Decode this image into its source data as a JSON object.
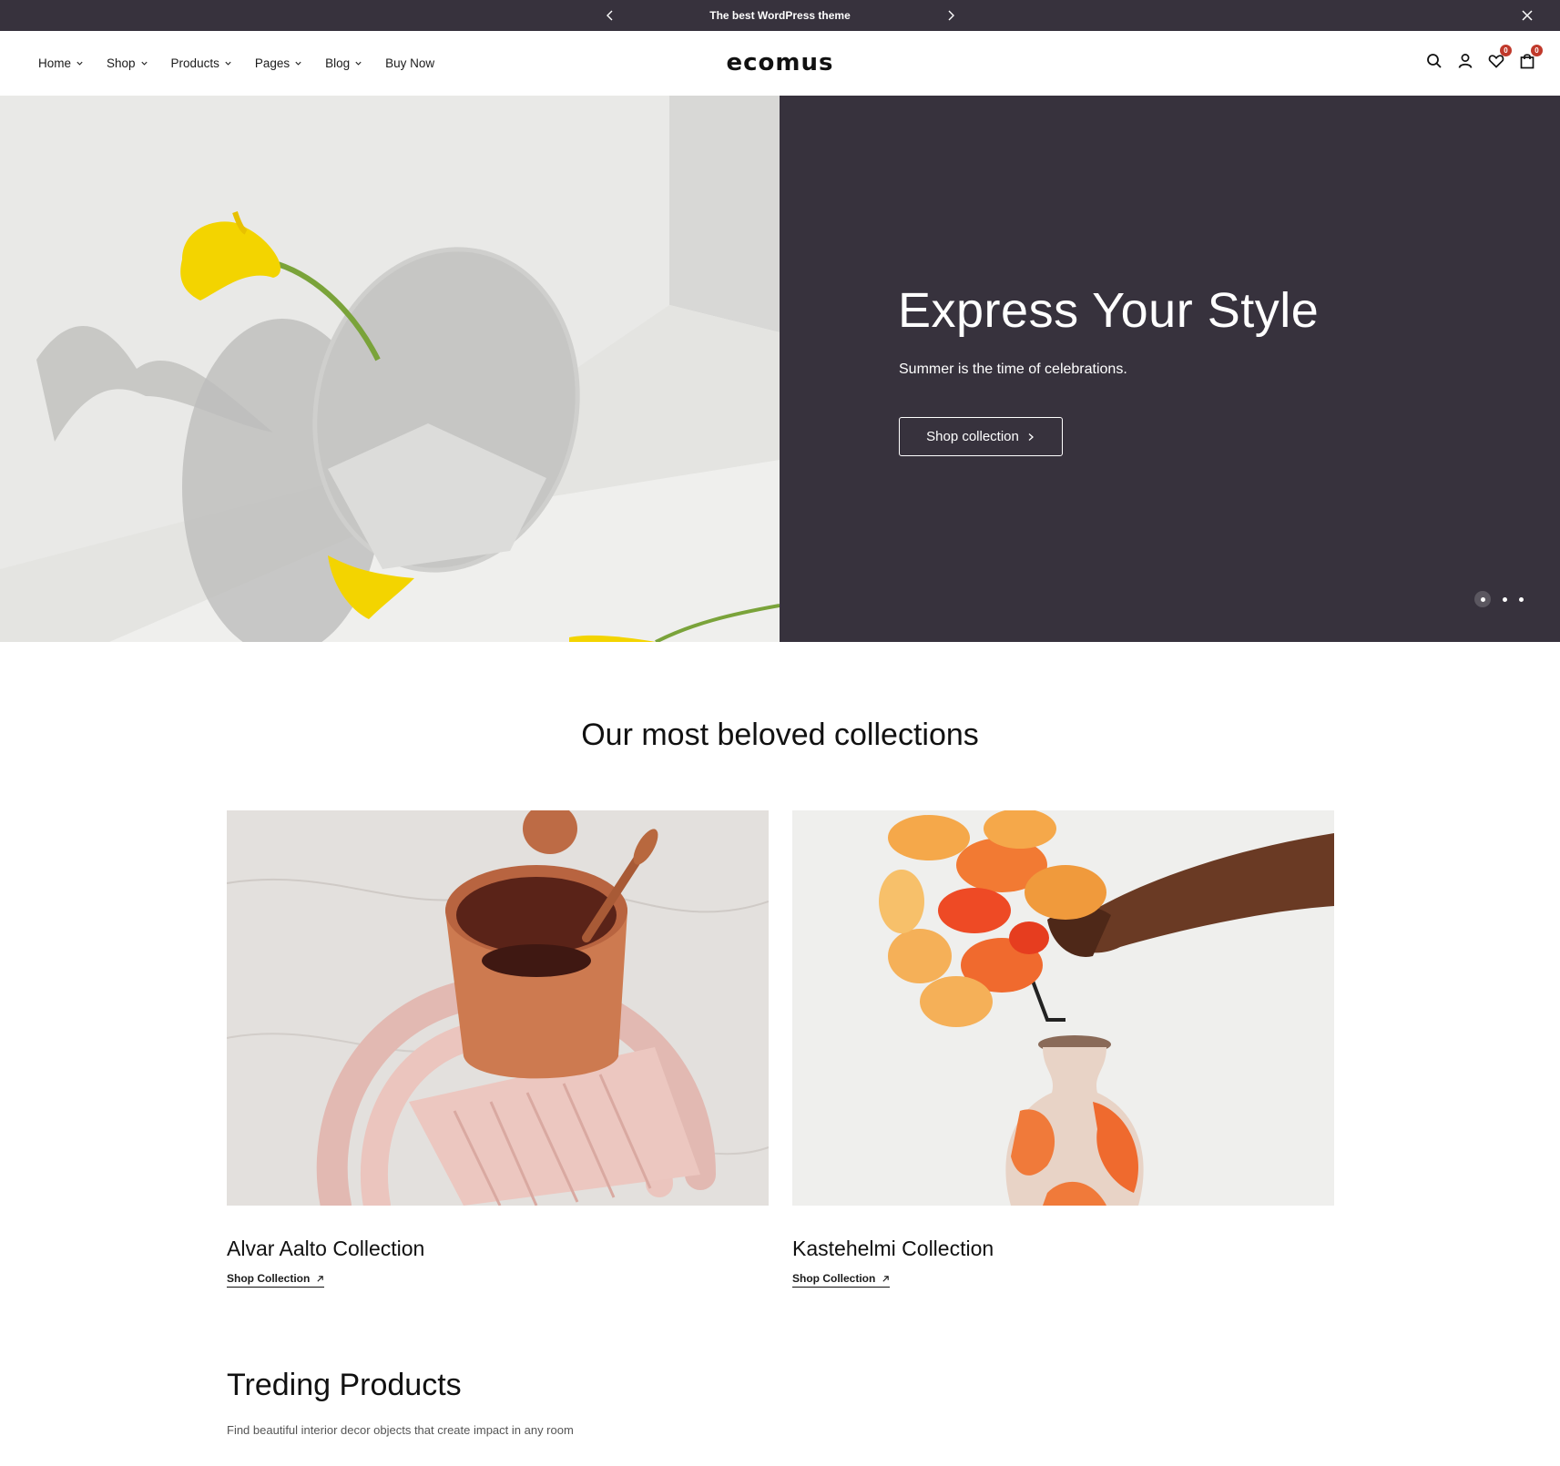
{
  "announcement": {
    "text": "The best WordPress theme",
    "bg_color": "#37323d"
  },
  "header": {
    "logo": "ecomus",
    "nav": [
      {
        "label": "Home",
        "has_dropdown": true
      },
      {
        "label": "Shop",
        "has_dropdown": true
      },
      {
        "label": "Products",
        "has_dropdown": true
      },
      {
        "label": "Pages",
        "has_dropdown": true
      },
      {
        "label": "Blog",
        "has_dropdown": true
      },
      {
        "label": "Buy Now",
        "has_dropdown": false
      }
    ],
    "icons": [
      "search-icon",
      "user-icon",
      "heart-icon",
      "bag-icon"
    ],
    "wishlist_count": "0",
    "cart_count": "0",
    "badge_color": "#c0392b"
  },
  "hero": {
    "title": "Express Your Style",
    "subtitle": "Summer is the time of celebrations.",
    "button_label": "Shop collection",
    "panel_color": "#37323d",
    "slide_count": 3,
    "active_slide": 1
  },
  "collections": {
    "title": "Our most beloved collections",
    "items": [
      {
        "name": "Alvar Aalto Collection",
        "link_label": "Shop Collection"
      },
      {
        "name": "Kastehelmi Collection",
        "link_label": "Shop Collection"
      }
    ]
  },
  "trending": {
    "title": "Treding Products",
    "subtitle": "Find beautiful interior decor objects that create impact in any room"
  }
}
